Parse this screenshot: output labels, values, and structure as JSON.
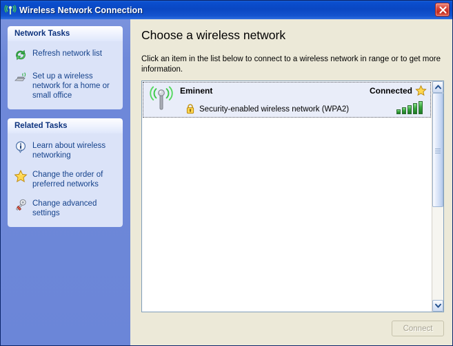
{
  "window": {
    "title": "Wireless Network Connection",
    "title_icon": "wireless-signal-icon",
    "close_icon": "close-icon",
    "accent_titlebar": "#0a47c2",
    "sidebar_bg": "#6c87d8",
    "content_bg": "#ece9d8"
  },
  "sidebar": {
    "panels": [
      {
        "header": "Network Tasks",
        "items": [
          {
            "label": "Refresh network list",
            "icon": "refresh-icon"
          },
          {
            "label": "Set up a wireless network for a home or small office",
            "icon": "wireless-device-icon"
          }
        ]
      },
      {
        "header": "Related Tasks",
        "items": [
          {
            "label": "Learn about wireless networking",
            "icon": "info-icon"
          },
          {
            "label": "Change the order of preferred networks",
            "icon": "star-icon"
          },
          {
            "label": "Change advanced settings",
            "icon": "tools-icon"
          }
        ]
      }
    ]
  },
  "main": {
    "title": "Choose a wireless network",
    "instructions": "Click an item in the list below to connect to a wireless network in range or to get more information.",
    "networks": [
      {
        "ssid": "Eminent",
        "status": "Connected",
        "status_icon": "star-icon",
        "antenna_icon": "wireless-antenna-icon",
        "security_icon": "lock-icon",
        "security": "Security-enabled wireless network (WPA2)",
        "signal_bars": 5,
        "signal_max": 5,
        "selected": true
      }
    ]
  },
  "scrollbar": {
    "up_icon": "chevron-up-icon",
    "down_icon": "chevron-down-icon",
    "thumb_position_percent": 0
  },
  "footer": {
    "connect_label": "Connect",
    "connect_enabled": false
  }
}
